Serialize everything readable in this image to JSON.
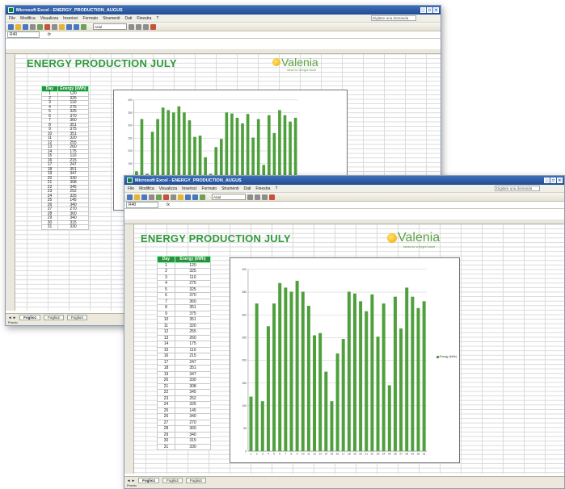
{
  "app": {
    "title": "Microsoft Excel - ENERGY_PRODUCTION_AUGUS",
    "menu": [
      "File",
      "Modifica",
      "Visualizza",
      "Inserisci",
      "Formato",
      "Strumenti",
      "Dati",
      "Finestra",
      "?"
    ],
    "help_placeholder": "Digitare una domanda",
    "font_name": "Arial",
    "name_box": "R40",
    "fx_label": "fx",
    "sheet_tabs": [
      "Foglio1",
      "Foglio2",
      "Foglio3"
    ],
    "status": "Pronto"
  },
  "sheet": {
    "title": "ENERGY PRODUCTION JULY",
    "logo_name": "Valenia",
    "logo_tagline": "Ideas for a bright future",
    "headers": [
      "Day",
      "Energy (kWh)"
    ],
    "rows": [
      [
        "1",
        "120"
      ],
      [
        "2",
        "325"
      ],
      [
        "3",
        "110"
      ],
      [
        "4",
        "275"
      ],
      [
        "5",
        "325"
      ],
      [
        "6",
        "370"
      ],
      [
        "7",
        "360"
      ],
      [
        "8",
        "351"
      ],
      [
        "9",
        "375"
      ],
      [
        "10",
        "351"
      ],
      [
        "11",
        "320"
      ],
      [
        "12",
        "255"
      ],
      [
        "13",
        "260"
      ],
      [
        "14",
        "175"
      ],
      [
        "15",
        "110"
      ],
      [
        "16",
        "215"
      ],
      [
        "17",
        "247"
      ],
      [
        "18",
        "351"
      ],
      [
        "19",
        "347"
      ],
      [
        "20",
        "330"
      ],
      [
        "21",
        "308"
      ],
      [
        "22",
        "345"
      ],
      [
        "23",
        "252"
      ],
      [
        "24",
        "325"
      ],
      [
        "25",
        "145"
      ],
      [
        "26",
        "340"
      ],
      [
        "27",
        "270"
      ],
      [
        "28",
        "360"
      ],
      [
        "29",
        "340"
      ],
      [
        "30",
        "315"
      ],
      [
        "31",
        "330"
      ]
    ]
  },
  "chart_data": {
    "type": "bar",
    "categories": [
      "1",
      "2",
      "3",
      "4",
      "5",
      "6",
      "7",
      "8",
      "9",
      "10",
      "11",
      "12",
      "13",
      "14",
      "15",
      "16",
      "17",
      "18",
      "19",
      "20",
      "21",
      "22",
      "23",
      "24",
      "25",
      "26",
      "27",
      "28",
      "29",
      "30",
      "31"
    ],
    "series": [
      {
        "name": "Energy (kWh)",
        "values": [
          120,
          325,
          110,
          275,
          325,
          370,
          360,
          351,
          375,
          351,
          320,
          255,
          260,
          175,
          110,
          215,
          247,
          351,
          347,
          330,
          308,
          345,
          252,
          325,
          145,
          340,
          270,
          360,
          340,
          315,
          330
        ]
      }
    ],
    "ylim": [
      0,
      400
    ],
    "yticks": [
      "0",
      "50",
      "100",
      "150",
      "200",
      "250",
      "300",
      "350",
      "400"
    ],
    "grid": true,
    "legend": "right",
    "color": "#4fa03d"
  }
}
